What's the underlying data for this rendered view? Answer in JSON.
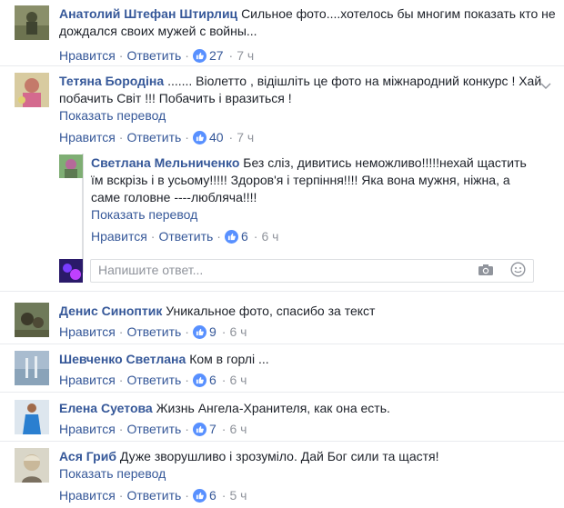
{
  "actions": {
    "like": "Нравится",
    "reply": "Ответить",
    "separator": "·"
  },
  "translate_label": "Показать перевод",
  "comments": [
    {
      "author": "Анатолий Штефан Штирлиц",
      "text": "Сильное фото....хотелось бы многим показать кто не дождался своих мужей с войны...",
      "likes": "27",
      "time": "7 ч"
    },
    {
      "author": "Тетяна Бородіна",
      "text": "....... Віолетто , відішліть це фото на міжнародний конкурс ! Хай побачить Світ !!! Побачить і вразиться !",
      "likes": "40",
      "time": "7 ч",
      "replies": [
        {
          "author": "Светлана Мельниченко",
          "text": "Без сліз, дивитись неможливо!!!!!нехай щастить їм вскрізь і в усьому!!!!! Здоров'я і терпіння!!!! Яка вона мужня, ніжна, а саме головне ----любляча!!!!",
          "likes": "6",
          "time": "6 ч"
        }
      ]
    },
    {
      "author": "Денис Синоптик",
      "text": "Уникальное фото, спасибо за текст",
      "likes": "9",
      "time": "6 ч"
    },
    {
      "author": "Шевченко Светлана",
      "text": "Ком в горлі ...",
      "likes": "6",
      "time": "6 ч"
    },
    {
      "author": "Елена Суетова",
      "text": "Жизнь Ангела-Хранителя, как она есть.",
      "likes": "7",
      "time": "6 ч"
    },
    {
      "author": "Ася Гриб",
      "text": "Дуже зворушливо і зрозуміло. Дай Бог сили та щастя!",
      "likes": "6",
      "time": "5 ч"
    }
  ],
  "reply_box": {
    "placeholder": "Напишите ответ..."
  },
  "colors": {
    "link": "#365899",
    "meta": "#90949c",
    "like_blue": "#5890ff"
  }
}
